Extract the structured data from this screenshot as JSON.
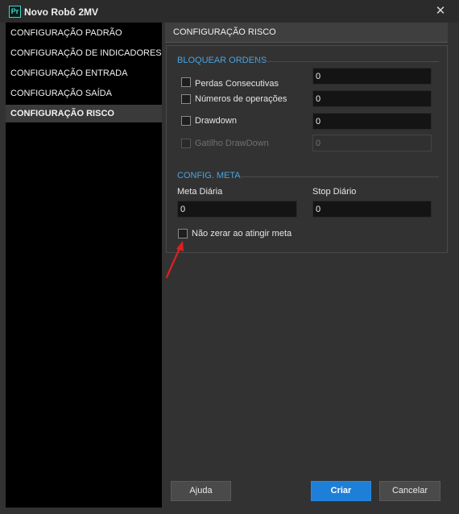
{
  "window": {
    "title": "Novo Robô 2MV",
    "app_icon_text": "Pr",
    "close_glyph": "✕"
  },
  "sidebar": {
    "items": [
      {
        "label": "CONFIGURAÇÃO PADRÃO",
        "active": false
      },
      {
        "label": "CONFIGURAÇÃO DE INDICADORES",
        "active": false
      },
      {
        "label": "CONFIGURAÇÃO ENTRADA",
        "active": false
      },
      {
        "label": "CONFIGURAÇÃO SAÍDA",
        "active": false
      },
      {
        "label": "CONFIGURAÇÃO RISCO",
        "active": true
      }
    ]
  },
  "main": {
    "section_title": "CONFIGURAÇÃO RISCO",
    "bloquear": {
      "title": "BLOQUEAR ORDENS",
      "rows": [
        {
          "label": "Perdas Consecutivas",
          "checked": false,
          "enabled": true,
          "value": "0"
        },
        {
          "label": "Números de operações",
          "checked": false,
          "enabled": true,
          "value": "0"
        },
        {
          "label": "Drawdown",
          "checked": false,
          "enabled": true,
          "value": "0"
        },
        {
          "label": "Gatilho DrawDown",
          "checked": false,
          "enabled": false,
          "value": "0"
        }
      ]
    },
    "meta": {
      "title": "CONFIG. META",
      "meta_diaria_label": "Meta Diária",
      "meta_diaria_value": "0",
      "stop_diario_label": "Stop Diário",
      "stop_diario_value": "0",
      "nao_zerar_label": "Não zerar ao atingir meta",
      "nao_zerar_checked": false
    }
  },
  "footer": {
    "help_label": "Ajuda",
    "create_label": "Criar",
    "cancel_label": "Cancelar"
  },
  "colors": {
    "accent": "#1d7fd8",
    "group_title": "#4aa3df",
    "annotation_arrow": "#e02020"
  }
}
